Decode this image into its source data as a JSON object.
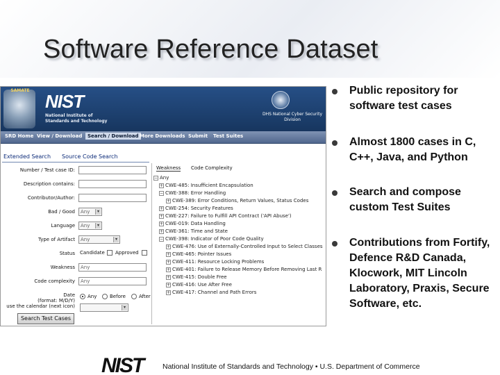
{
  "slide": {
    "title": "Software Reference Dataset"
  },
  "screenshot": {
    "banner": {
      "seal_text": "SAMATE",
      "logo": "NIST",
      "org_line1": "National Institute of",
      "org_line2": "Standards and Technology",
      "dhs_line1": "DHS National Cyber Security",
      "dhs_line2": "Division"
    },
    "nav": [
      "SRD Home",
      "View / Download",
      "Search / Download",
      "More Downloads",
      "Submit",
      "Test Suites"
    ],
    "tabs": [
      "Extended Search",
      "Source Code Search"
    ],
    "form": {
      "number_label": "Number / Test case ID:",
      "description_label": "Description contains:",
      "contributor_label": "Contributor/Author:",
      "bad_good_label": "Bad / Good",
      "bad_good_value": "Any",
      "language_label": "Language",
      "language_value": "Any",
      "artifact_label": "Type of Artifact",
      "artifact_value": "Any",
      "status_label": "Status",
      "status_opt1": "Candidate",
      "status_opt2": "Approved",
      "weakness_label": "Weakness",
      "weakness_value": "Any",
      "complexity_label": "Code complexity",
      "complexity_value": "Any",
      "date_label_line1": "Date",
      "date_label_line2": "(format: M/D/Y)",
      "date_label_line3": "use the calendar (next icon)",
      "date_opt1": "Any",
      "date_opt2": "Before",
      "date_opt3": "After",
      "search_button": "Search Test Cases"
    },
    "tree": {
      "tabs": [
        "Weakness",
        "Code Complexity"
      ],
      "items": [
        "Any",
        "CWE-485: Insufficient Encapsulation",
        "CWE-388: Error Handling",
        "CWE-389: Error Conditions, Return Values, Status Codes",
        "CWE-254: Security Features",
        "CWE-227: Failure to Fulfill API Contract ('API Abuse')",
        "CWE-019: Data Handling",
        "CWE-361: Time and State",
        "CWE-398: Indicator of Poor Code Quality",
        "CWE-476: Use of Externally-Controlled Input to Select Classes",
        "CWE-465: Pointer Issues",
        "CWE-411: Resource Locking Problems",
        "CWE-401: Failure to Release Memory Before Removing Last R",
        "CWE-415: Double Free",
        "CWE-416: Use After Free",
        "CWE-417: Channel and Path Errors"
      ]
    }
  },
  "bullets": [
    "Public repository for software test cases",
    "Almost 1800 cases in C, C++, Java, and Python",
    "Search and compose custom Test Suites",
    "Contributions from Fortify, Defence R&D Canada, Klocwork, MIT Lincoln Laboratory, Praxis, Secure Software, etc."
  ],
  "footer": {
    "logo": "NIST",
    "text": "National Institute of Standards and Technology • U.S. Department of Commerce"
  }
}
